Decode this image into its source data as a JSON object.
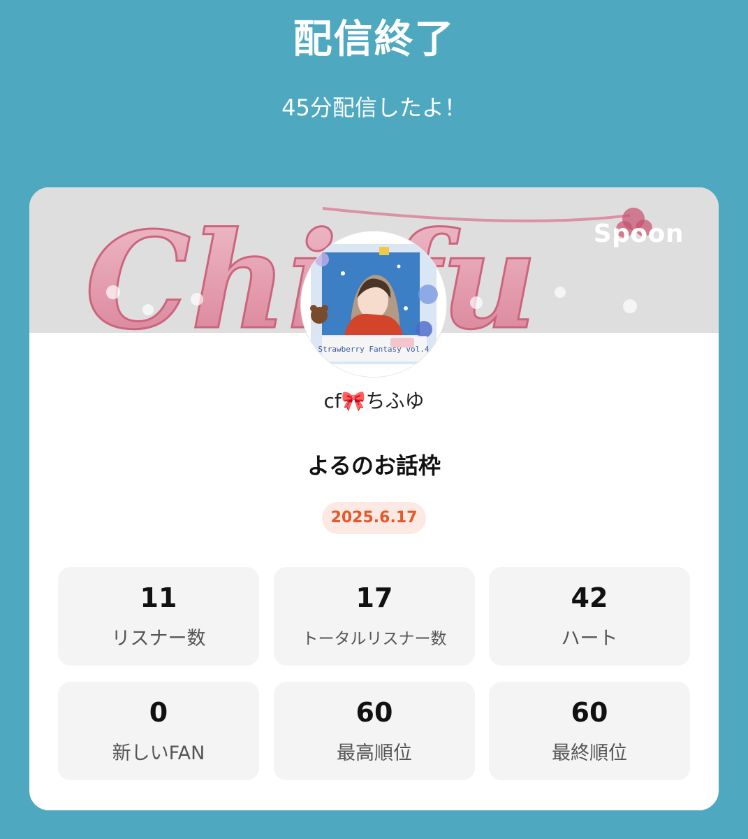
{
  "header": {
    "title": "配信終了",
    "subtitle": "45分配信したよ！"
  },
  "card": {
    "brand": "Spoon",
    "banner_text": "Chi fu",
    "username": "cf🎀ちふゆ",
    "broadcast_title": "よるのお話枠",
    "date": "2025.6.17",
    "avatar_caption": "Strawberry Fantasy vol.4"
  },
  "stats": [
    {
      "value": "11",
      "label": "リスナー数"
    },
    {
      "value": "17",
      "label": "トータルリスナー数"
    },
    {
      "value": "42",
      "label": "ハート"
    },
    {
      "value": "0",
      "label": "新しいFAN"
    },
    {
      "value": "60",
      "label": "最高順位"
    },
    {
      "value": "60",
      "label": "最終順位"
    }
  ],
  "colors": {
    "background": "#4ea8c0",
    "card": "#ffffff",
    "stat_tile": "#f4f4f4",
    "date_text": "#e05a2c",
    "date_bg": "#fde9e3"
  }
}
